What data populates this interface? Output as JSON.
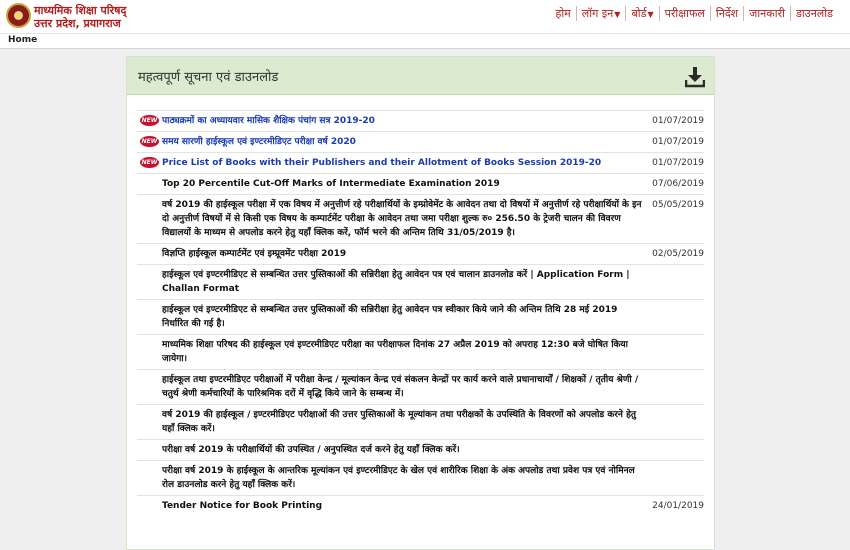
{
  "header": {
    "org_line1": "माध्यमिक शिक्षा परिषद्",
    "org_line2": "उत्तर प्रदेश, प्रयागराज",
    "nav": [
      {
        "label": "होम",
        "dropdown": false
      },
      {
        "label": "लॉग इन",
        "dropdown": true
      },
      {
        "label": "बोर्ड",
        "dropdown": true
      },
      {
        "label": "परीक्षाफल",
        "dropdown": false
      },
      {
        "label": "निर्देश",
        "dropdown": false
      },
      {
        "label": "जानकारी",
        "dropdown": false
      },
      {
        "label": "डाउनलोड",
        "dropdown": false
      }
    ]
  },
  "breadcrumb": "Home",
  "panel": {
    "title": "महत्वपूर्ण सूचना एवं डाउनलोड",
    "icon": "download-icon",
    "new_badge": "NEW",
    "items": [
      {
        "text": "पाठ्यक्रमों का अध्यायवार मासिक शैक्षिक पंचांग सत्र 2019-20",
        "date": "01/07/2019",
        "is_new": true,
        "link": true
      },
      {
        "text": "समय सारणी हाईस्कूल एवं इण्टरमीडिएट परीक्षा वर्ष 2020",
        "date": "01/07/2019",
        "is_new": true,
        "link": true
      },
      {
        "text": "Price List of Books with their Publishers and their Allotment of Books Session 2019-20",
        "date": "01/07/2019",
        "is_new": true,
        "link": true
      },
      {
        "text": "Top 20 Percentile Cut-Off Marks of Intermediate Examination 2019",
        "date": "07/06/2019",
        "is_new": false,
        "link": false
      },
      {
        "text": "वर्ष 2019 की हाईस्कूल परीक्षा में एक विषय में अनुत्तीर्ण रहे परीक्षार्थियों के इम्प्रोवेमेंट के आवेदन तथा दो विषयों में अनुत्तीर्ण रहे परीक्षार्थियों के इन दो अनुत्तीर्ण विषयों में से किसी एक विषय के कम्पार्टमेंट परीक्षा के आवेदन तथा जमा परीक्षा शुल्क रु० 256.50 के ट्रेजरी चालन की विवरण विद्यालयों के माध्यम से अपलोड करने हेतु यहाँ क्लिक करें, फॉर्म भरने की अन्तिम तिथि 31/05/2019 है।",
        "date": "05/05/2019",
        "is_new": false,
        "link": false
      },
      {
        "text": "विज्ञप्ति हाईस्कूल कम्पार्टमेंट एवं इम्प्रूवमेंट परीक्षा 2019",
        "date": "02/05/2019",
        "is_new": false,
        "link": false
      },
      {
        "text": "हाईस्कूल एवं इण्टरमीडिएट से सम्बन्धित उत्तर पुस्तिकाओं की सन्निरीक्षा हेतु आवेदन पत्र एवं चालान डाउनलोड करें",
        "suffix": " | Application Form | Challan Format",
        "date": "",
        "is_new": false,
        "link": false
      },
      {
        "text": "हाईस्कूल एवं इण्टरमीडिएट से सम्बन्धित उत्तर पुस्तिकाओं की सन्निरीक्षा हेतु आवेदन पत्र स्वीकार किये जाने की अन्तिम तिथि 28 मई 2019 निर्धारित की गई है।",
        "date": "",
        "is_new": false,
        "link": false
      },
      {
        "text": "माध्यमिक शिक्षा परिषद की हाईस्कूल एवं इण्टरमीडिएट परीक्षा का परीक्षाफल दिनांक 27 अप्रैल 2019 को अपराह 12:30 बजे घोषित किया जायेगा।",
        "date": "",
        "is_new": false,
        "link": false
      },
      {
        "text": "हाईस्कूल तथा इण्टरमीडिएट परीक्षाओं में परीक्षा केन्द्र / मूल्यांकन केन्द्र एवं संकलन केन्द्रों पर कार्य करने वाले प्रधानाचार्यों / शिक्षकों / तृतीय श्रेणी / चतुर्थ श्रेणी कर्मचारियों के पारिश्रमिक दरों में वृद्धि किये जाने के सम्बन्ध में।",
        "date": "",
        "is_new": false,
        "link": false
      },
      {
        "text": "वर्ष 2019 की हाईस्कूल / इण्टरमीडिएट परीक्षाओं की उत्तर पुस्तिकाओं के मूल्यांकन तथा परीक्षकों के उपस्थिति के विवरणों को अपलोड करने हेतु यहाँ क्लिक करें।",
        "date": "",
        "is_new": false,
        "link": false
      },
      {
        "text": "परीक्षा वर्ष 2019 के परीक्षार्थियों की उपस्थित / अनुपस्थित दर्ज करने हेतु यहाँ क्लिक करें।",
        "date": "",
        "is_new": false,
        "link": false
      },
      {
        "text": "परीक्षा वर्ष 2019 के हाईस्कूल के आन्तरिक मूल्यांकन एवं इण्टरमीडिएट के खेल एवं शारीरिक शिक्षा के अंक अपलोड तथा प्रवेश पत्र एवं नोमिनल रोल डाउनलोड करने हेतु यहाँ क्लिक करें।",
        "date": "",
        "is_new": false,
        "link": false
      },
      {
        "text": "Tender Notice for Book Printing",
        "date": "24/01/2019",
        "is_new": false,
        "link": false
      }
    ]
  }
}
